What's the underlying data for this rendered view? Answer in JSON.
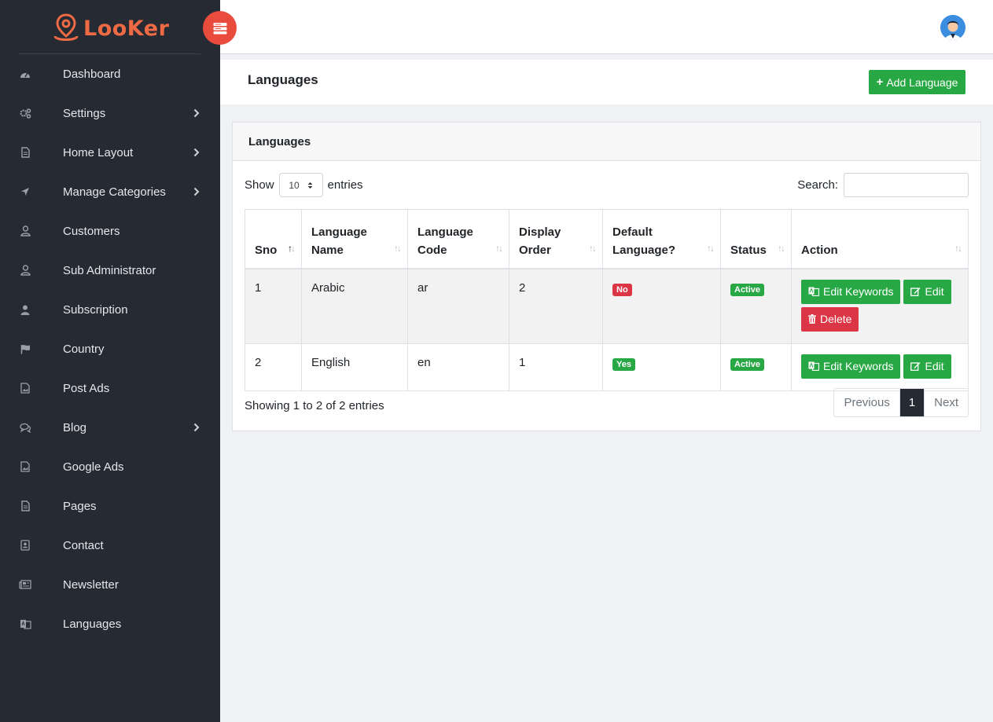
{
  "brand": {
    "name": "LooKer"
  },
  "colors": {
    "sidebar": "#262b33",
    "accent": "#ee6a45",
    "toggle": "#e94b3c",
    "success": "#28a745",
    "danger": "#dc3545"
  },
  "sidebar": {
    "items": [
      {
        "label": "Dashboard",
        "icon": "dashboard-icon",
        "submenu": false
      },
      {
        "label": "Settings",
        "icon": "cogs-icon",
        "submenu": true
      },
      {
        "label": "Home Layout",
        "icon": "file-icon",
        "submenu": true
      },
      {
        "label": "Manage Categories",
        "icon": "location-arrow-icon",
        "submenu": true
      },
      {
        "label": "Customers",
        "icon": "user-icon",
        "submenu": false
      },
      {
        "label": "Sub Administrator",
        "icon": "user-icon",
        "submenu": false
      },
      {
        "label": "Subscription",
        "icon": "user-solid-icon",
        "submenu": false
      },
      {
        "label": "Country",
        "icon": "flag-icon",
        "submenu": false
      },
      {
        "label": "Post Ads",
        "icon": "image-icon",
        "submenu": false
      },
      {
        "label": "Blog",
        "icon": "comments-icon",
        "submenu": true
      },
      {
        "label": "Google Ads",
        "icon": "image-icon",
        "submenu": false
      },
      {
        "label": "Pages",
        "icon": "file-icon",
        "submenu": false
      },
      {
        "label": "Contact",
        "icon": "address-book-icon",
        "submenu": false
      },
      {
        "label": "Newsletter",
        "icon": "newspaper-icon",
        "submenu": false
      },
      {
        "label": "Languages",
        "icon": "language-icon",
        "submenu": false
      }
    ]
  },
  "header": {
    "title": "Languages",
    "add_button": "Add Language"
  },
  "card": {
    "title": "Languages",
    "show_label": "Show",
    "entries_value": "10",
    "entries_label": "entries",
    "search_label": "Search:",
    "search_value": ""
  },
  "table": {
    "columns": [
      {
        "line1": "Sno",
        "line2": ""
      },
      {
        "line1": "Language",
        "line2": "Name"
      },
      {
        "line1": "Language",
        "line2": "Code"
      },
      {
        "line1": "Display",
        "line2": "Order"
      },
      {
        "line1": "Default",
        "line2": "Language?"
      },
      {
        "line1": "Status",
        "line2": ""
      },
      {
        "line1": "Action",
        "line2": ""
      }
    ],
    "rows": [
      {
        "sno": "1",
        "name": "Arabic",
        "code": "ar",
        "order": "2",
        "default": "No",
        "status": "Active",
        "actions": [
          "Edit Keywords",
          "Edit",
          "Delete"
        ]
      },
      {
        "sno": "2",
        "name": "English",
        "code": "en",
        "order": "1",
        "default": "Yes",
        "status": "Active",
        "actions": [
          "Edit Keywords",
          "Edit"
        ]
      }
    ]
  },
  "footer": {
    "info": "Showing 1 to 2 of 2 entries",
    "previous": "Previous",
    "page": "1",
    "next": "Next"
  }
}
